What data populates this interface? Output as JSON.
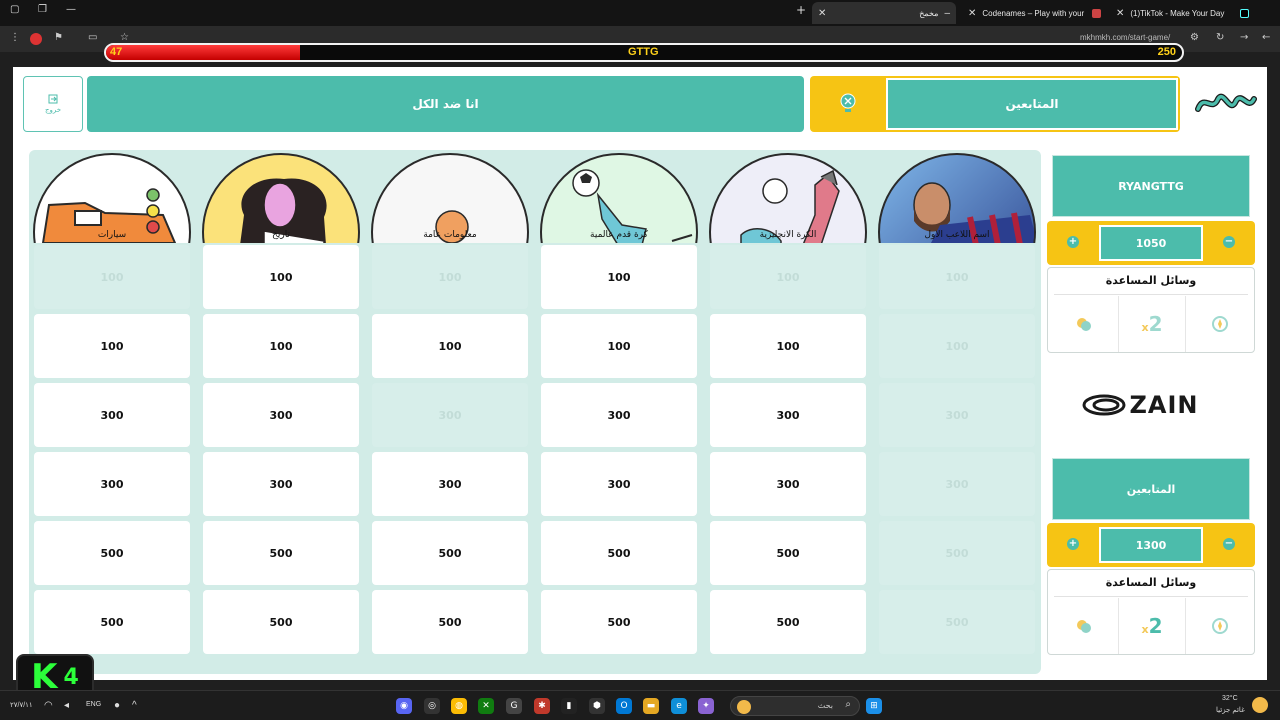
{
  "browser": {
    "tabs": [
      {
        "title": "مخمخ",
        "active": true
      },
      {
        "title": "Codenames – Play with your Fr",
        "active": false
      },
      {
        "title": "(1)TikTok - Make Your Day",
        "active": false
      }
    ],
    "url": "mkhmkh.com/start-game/",
    "new_tab": "+"
  },
  "overlay": {
    "left_value": "47",
    "center_label": "GTTG",
    "right_value": "250",
    "fill_fraction": 0.18
  },
  "header": {
    "exit_label": "خروج",
    "left_title": "انا ضد الكل",
    "right_title": "المتابعين"
  },
  "categories": [
    {
      "label": "اسم اللاعب الاول",
      "icon": "player-photo-icon"
    },
    {
      "label": "الكرة الانجليزية",
      "icon": "football-kick-icon"
    },
    {
      "label": "كرة قدم عالمية",
      "icon": "goalkeeper-icon"
    },
    {
      "label": "معلومات عامة",
      "icon": "general-knowledge-icon"
    },
    {
      "label": "تاريخ",
      "icon": "history-icon"
    },
    {
      "label": "سيارات",
      "icon": "car-icon"
    }
  ],
  "grid": {
    "rows": [
      [
        {
          "v": "100",
          "used": true
        },
        {
          "v": "100",
          "used": true
        },
        {
          "v": "100",
          "used": false
        },
        {
          "v": "100",
          "used": true
        },
        {
          "v": "100",
          "used": false
        },
        {
          "v": "100",
          "used": true
        }
      ],
      [
        {
          "v": "100",
          "used": true
        },
        {
          "v": "100",
          "used": false
        },
        {
          "v": "100",
          "used": false
        },
        {
          "v": "100",
          "used": false
        },
        {
          "v": "100",
          "used": false
        },
        {
          "v": "100",
          "used": false
        }
      ],
      [
        {
          "v": "300",
          "used": true
        },
        {
          "v": "300",
          "used": false
        },
        {
          "v": "300",
          "used": false
        },
        {
          "v": "300",
          "used": true
        },
        {
          "v": "300",
          "used": false
        },
        {
          "v": "300",
          "used": false
        }
      ],
      [
        {
          "v": "300",
          "used": true
        },
        {
          "v": "300",
          "used": false
        },
        {
          "v": "300",
          "used": false
        },
        {
          "v": "300",
          "used": false
        },
        {
          "v": "300",
          "used": false
        },
        {
          "v": "300",
          "used": false
        }
      ],
      [
        {
          "v": "500",
          "used": true
        },
        {
          "v": "500",
          "used": false
        },
        {
          "v": "500",
          "used": false
        },
        {
          "v": "500",
          "used": false
        },
        {
          "v": "500",
          "used": false
        },
        {
          "v": "500",
          "used": false
        }
      ],
      [
        {
          "v": "500",
          "used": true
        },
        {
          "v": "500",
          "used": false
        },
        {
          "v": "500",
          "used": false
        },
        {
          "v": "500",
          "used": false
        },
        {
          "v": "500",
          "used": false
        },
        {
          "v": "500",
          "used": false
        }
      ]
    ]
  },
  "teams": [
    {
      "name": "RYANGTTG",
      "score": "1050",
      "aids_title": "وسائل المساعدة"
    },
    {
      "name": "المتابعين",
      "score": "1300",
      "aids_title": "وسائل المساعدة"
    }
  ],
  "sponsor": {
    "name": "ZAIN"
  },
  "stream_badge": {
    "letter": "K",
    "digit": "4"
  },
  "taskbar": {
    "lang": "ENG",
    "search_placeholder": "بحث",
    "weather": "32°C",
    "weather_desc": "غائم جزئيا",
    "date": "٢٧/٧/١١"
  },
  "colors": {
    "teal": "#4cbcab",
    "yellow": "#f6c414",
    "red": "#e00000"
  }
}
